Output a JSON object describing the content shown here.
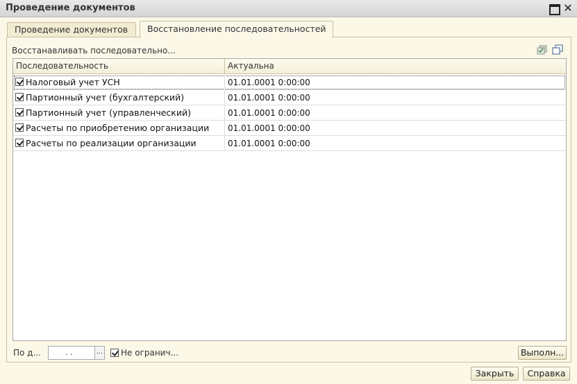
{
  "window": {
    "title": "Проведение документов"
  },
  "tabs": [
    {
      "label": "Проведение документов"
    },
    {
      "label": "Восстановление последовательностей"
    }
  ],
  "section": {
    "label": "Восстанавливать последовательно..."
  },
  "table": {
    "columns": [
      "Последовательность",
      "Актуальна"
    ],
    "rows": [
      {
        "name": "Налоговый учет УСН",
        "date": "01.01.0001 0:00:00",
        "checked": true
      },
      {
        "name": "Партионный учет (бухгалтерский)",
        "date": "01.01.0001 0:00:00",
        "checked": true
      },
      {
        "name": "Партионный учет (управленческий)",
        "date": "01.01.0001 0:00:00",
        "checked": true
      },
      {
        "name": "Расчеты по приобретению организации",
        "date": "01.01.0001 0:00:00",
        "checked": true
      },
      {
        "name": "Расчеты по реализации организации",
        "date": "01.01.0001 0:00:00",
        "checked": true
      }
    ]
  },
  "bottom": {
    "po_label": "По д...",
    "date_value": ". .",
    "date_button": "...",
    "no_limit_label": "Не огранич...",
    "no_limit_checked": true,
    "execute_label": "Выполн..."
  },
  "footer": {
    "close_label": "Закрыть",
    "help_label": "Справка"
  },
  "icons": [
    "maximize-icon",
    "close-icon",
    "check-all-icon",
    "uncheck-all-icon"
  ],
  "colors": {
    "background": "#fbf8e8",
    "titlebar": "#d4d4d4",
    "border": "#c7bfa0"
  }
}
